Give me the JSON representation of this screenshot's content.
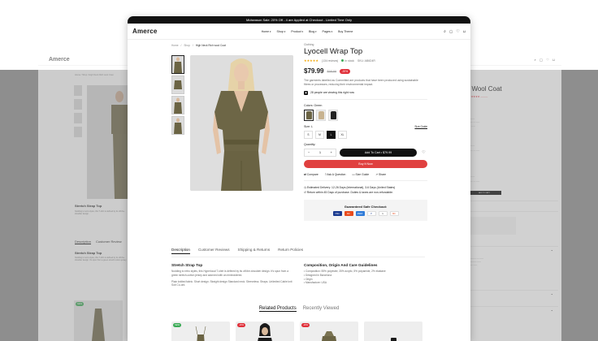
{
  "promo": "Midseason Sale: 20% Off - 4 are Applied at Checkout - Limited Time Only",
  "brand": "Amerce",
  "nav": [
    "Home",
    "Shop",
    "Product",
    "Blog",
    "Pages",
    "Buy Theme"
  ],
  "breadcrumb": [
    "Home",
    "Shop",
    "High Neck Rich wool Coat"
  ],
  "product": {
    "category": "Clothing",
    "title": "Lyocell Wrap Top",
    "reviews": "(134 reviews)",
    "stock": "In stock",
    "sku": "SKU: AB6D4R",
    "stars": 5,
    "price": "$79.99",
    "old_price": "$98.99",
    "discount": "-20%",
    "description": "The garments labelled as Committed are products that have been produced using sustainable fibres or processes, reducing their environmental impact.",
    "sold": "28 people are viewing this right now",
    "color_label": "Colors: Green",
    "size_label": "Size: L",
    "sizes": [
      "S",
      "M",
      "L",
      "XL"
    ],
    "selected_size": "L",
    "size_guide": "Size Guide",
    "qty_label": "Quantity:",
    "qty": "1",
    "add_to_cart": "Add To Cart • $79.99",
    "buy_now": "Buy It Now",
    "actions": [
      "Compare",
      "Ask A Question",
      "Size Guide",
      "Share"
    ],
    "delivery": "Estimated Delivery: 12-26 Days (International), 3-6 Days (United States)",
    "returns": "Return within 45 Days of purchase. Duties & taxes are non-refundable.",
    "safe_checkout": "Guaranteed Safe Checkout:",
    "payments": [
      "VISA",
      "MC",
      "AMEX",
      "P",
      "G",
      "MC"
    ]
  },
  "tabs": [
    "Description",
    "Customer Reviews",
    "Shipping & Returns",
    "Return Policies"
  ],
  "desc_section": {
    "title": "Stretch Strap Top",
    "body": "Nodding to retro styles, this Hyperlocal T-shirt is defined by its off-the-shoulder design. It's spun from a green stretch-cotton jersey and adorned with an embroidered.",
    "body2": "Plain knitted fabric. Short design. Straight design Standard neck. Sleeveless. Straps. Unlimited Cable knit Sub Co-ord."
  },
  "comp_section": {
    "title": "Composition, Origin And Care Guidelines",
    "items": [
      "Composition: 55% polyester, 35% acrylic, 5% polyamide, 2% elastane",
      "Designed in Barcelona",
      "Origin",
      "Manufacture: USA"
    ]
  },
  "related_tabs": [
    "Related Products",
    "Recently Viewed"
  ],
  "cards": [
    {
      "tag": "NEW",
      "color": "#3aaa55"
    },
    {
      "tag": "-20%",
      "color": "#e0303a"
    },
    {
      "tag": "-20%",
      "color": "#e0303a"
    },
    {
      "tag": "",
      "color": ""
    }
  ],
  "left": {
    "brand": "Amerce",
    "title": "Stretch Strap Top",
    "tabs": [
      "Description",
      "Customer Review"
    ],
    "new_tag": "NEW"
  },
  "right": {
    "title": "di Wool Coat",
    "btn": "ADD TO CART"
  }
}
